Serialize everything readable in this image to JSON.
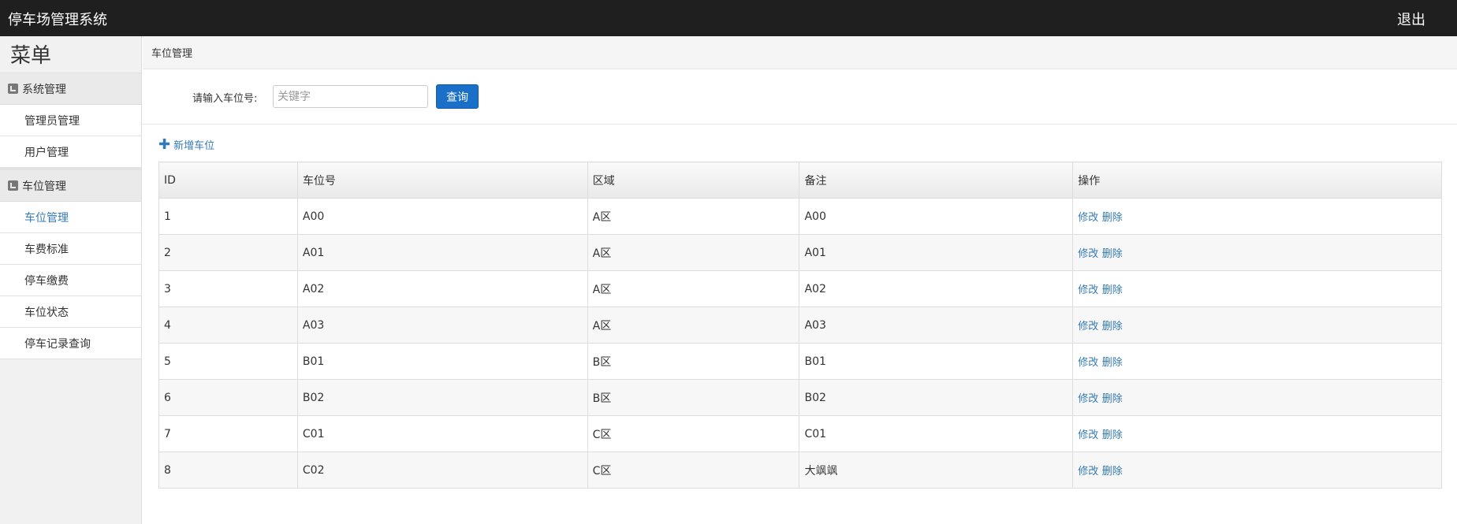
{
  "header": {
    "title": "停车场管理系统",
    "logout_label": "退出"
  },
  "sidebar": {
    "menu_title": "菜单",
    "groups": [
      {
        "label": "系统管理",
        "items": [
          {
            "label": "管理员管理"
          },
          {
            "label": "用户管理"
          }
        ]
      },
      {
        "label": "车位管理",
        "items": [
          {
            "label": "车位管理",
            "active": true
          },
          {
            "label": "车费标准"
          },
          {
            "label": "停车缴费"
          },
          {
            "label": "车位状态"
          },
          {
            "label": "停车记录查询"
          }
        ]
      }
    ]
  },
  "main": {
    "breadcrumb": "车位管理",
    "search": {
      "label": "请输入车位号:",
      "placeholder": "关键字",
      "value": "",
      "button_label": "查询"
    },
    "add_label": "新增车位",
    "table": {
      "columns": [
        "ID",
        "车位号",
        "区域",
        "备注",
        "操作"
      ],
      "edit_label": "修改",
      "delete_label": "删除",
      "rows": [
        {
          "id": "1",
          "number": "A00",
          "area": "A区",
          "note": "A00"
        },
        {
          "id": "2",
          "number": "A01",
          "area": "A区",
          "note": "A01"
        },
        {
          "id": "3",
          "number": "A02",
          "area": "A区",
          "note": "A02"
        },
        {
          "id": "4",
          "number": "A03",
          "area": "A区",
          "note": "A03"
        },
        {
          "id": "5",
          "number": "B01",
          "area": "B区",
          "note": "B01"
        },
        {
          "id": "6",
          "number": "B02",
          "area": "B区",
          "note": "B02"
        },
        {
          "id": "7",
          "number": "C01",
          "area": "C区",
          "note": "C01"
        },
        {
          "id": "8",
          "number": "C02",
          "area": "C区",
          "note": "大飒飒"
        }
      ]
    }
  },
  "colors": {
    "topbar": "#1f1f1f",
    "link": "#337ab7",
    "button": "#1a70c9",
    "sidebar_bg": "#f1f1f1"
  }
}
